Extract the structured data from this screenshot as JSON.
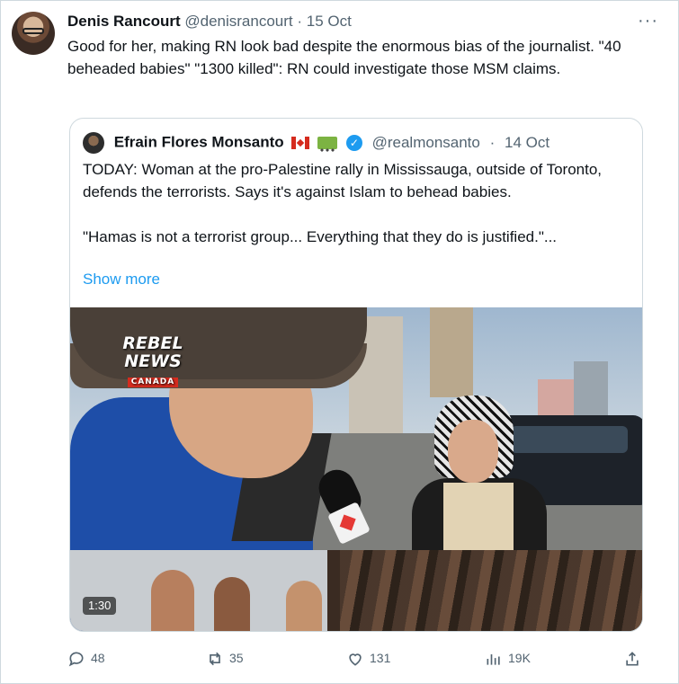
{
  "tweet": {
    "author": {
      "name": "Denis Rancourt",
      "handle": "@denisrancourt",
      "separator": "·",
      "date": "15 Oct"
    },
    "more_label": "···",
    "text": "Good for her, making RN look bad despite the enormous bias of the journalist. \"40 beheaded babies\" \"1300 killed\": RN could investigate those MSM claims.",
    "quoted": {
      "author_name": "Efrain Flores Monsanto",
      "verified_mark": "✓",
      "handle": "@realmonsanto",
      "separator": "·",
      "date": "14 Oct",
      "text": "TODAY: Woman at the pro-Palestine rally in Mississauga, outside of Toronto, defends the terrorists. Says it's against Islam to behead babies.\n\n\"Hamas is not a terrorist group... Everything that they do is justified.\"...",
      "show_more": "Show more",
      "video": {
        "logo_line1": "REBEL",
        "logo_line2": "NEWS",
        "logo_line3": "CANADA",
        "duration": "1:30"
      }
    },
    "actions": {
      "replies": "48",
      "reposts": "35",
      "likes": "131",
      "views": "19K"
    }
  },
  "icons": {
    "reply": "reply-icon",
    "repost": "repost-icon",
    "like": "heart-icon",
    "views": "views-icon",
    "share": "share-icon",
    "more": "more-icon",
    "verified": "verified-badge-icon",
    "flag": "canada-flag-icon",
    "truck": "truck-icon"
  },
  "colors": {
    "text": "#0f1419",
    "muted": "#536471",
    "link": "#1d9bf0",
    "border": "#cfd9de"
  }
}
